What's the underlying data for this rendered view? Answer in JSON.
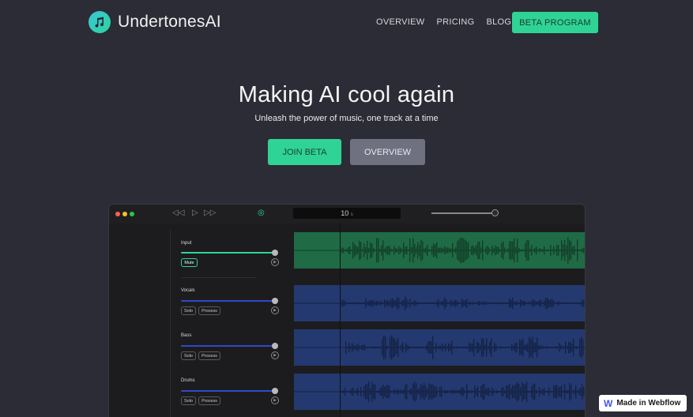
{
  "nav": {
    "brand": "UndertonesAI",
    "links": [
      "OVERVIEW",
      "PRICING",
      "BLOG"
    ],
    "cta": "BETA PROGRAM"
  },
  "hero": {
    "title": "Making AI cool again",
    "subtitle": "Unleash the power of music, one track at a time",
    "primary": "JOIN BETA",
    "secondary": "OVERVIEW"
  },
  "app": {
    "timer_value": "10",
    "timer_unit": "s",
    "tracks": [
      {
        "name": "Input",
        "buttons": [
          "Mute"
        ],
        "color": "#2fd494"
      },
      {
        "name": "Vocals",
        "buttons": [
          "Solo",
          "Process"
        ],
        "color": "#3148c9"
      },
      {
        "name": "Bass",
        "buttons": [
          "Solo",
          "Process"
        ],
        "color": "#3148c9"
      },
      {
        "name": "Drums",
        "buttons": [
          "Solo",
          "Process"
        ],
        "color": "#3148c9"
      }
    ]
  },
  "badge": {
    "label": "Made in Webflow"
  },
  "colors": {
    "accent": "#2fd494",
    "background": "#2b2c36",
    "secondary_button": "#6f7181"
  }
}
